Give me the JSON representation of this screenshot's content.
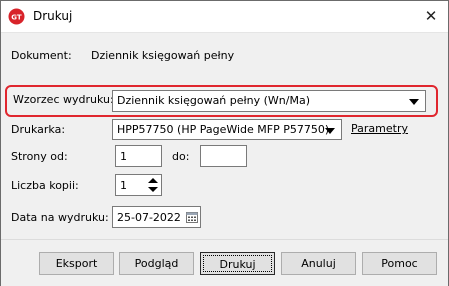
{
  "window": {
    "title": "Drukuj"
  },
  "document": {
    "label": "Dokument:",
    "value": "Dziennik księgowań pełny"
  },
  "template": {
    "label": "Wzorzec wydruku:",
    "value": "Dziennik księgowań pełny (Wn/Ma)"
  },
  "printer": {
    "label": "Drukarka:",
    "value": "HPP57750 (HP PageWide MFP P57750)",
    "params_link": "Parametry"
  },
  "pages": {
    "label_from": "Strony od:",
    "from_value": "1",
    "label_to": "do:",
    "to_value": ""
  },
  "copies": {
    "label": "Liczba kopii:",
    "value": "1"
  },
  "print_date": {
    "label": "Data na wydruku:",
    "value": "25-07-2022"
  },
  "buttons": {
    "export": "Eksport",
    "preview": "Podgląd",
    "print": "Drukuj",
    "cancel": "Anuluj",
    "help": "Pomoc"
  },
  "colors": {
    "highlight": "#e0262e",
    "title_bg": "#ffffff",
    "dialog_bg": "#f0f0f0"
  }
}
